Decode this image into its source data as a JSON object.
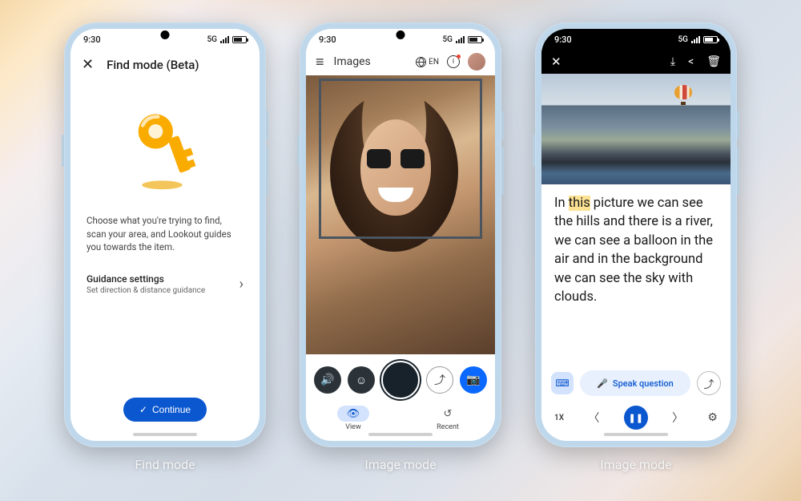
{
  "status": {
    "time": "9:30",
    "network": "5G"
  },
  "captions": {
    "p1": "Find mode",
    "p2": "Image mode",
    "p3": "Image mode"
  },
  "phone1": {
    "title": "Find mode (Beta)",
    "description": "Choose what you're trying to find, scan your area, and Lookout guides you towards the item.",
    "settings_title": "Guidance settings",
    "settings_sub": "Set direction & distance guidance",
    "continue": "Continue"
  },
  "phone2": {
    "section": "Images",
    "lang": "EN",
    "tabs": {
      "view": "View",
      "recent": "Recent"
    }
  },
  "phone3": {
    "desc_pre": "In ",
    "desc_hl": "this",
    "desc_post": " picture we can see the hills and there is a river, we can see a balloon in the air and in the background we can see the sky with clouds.",
    "speak": "Speak question",
    "speed": "1X"
  }
}
